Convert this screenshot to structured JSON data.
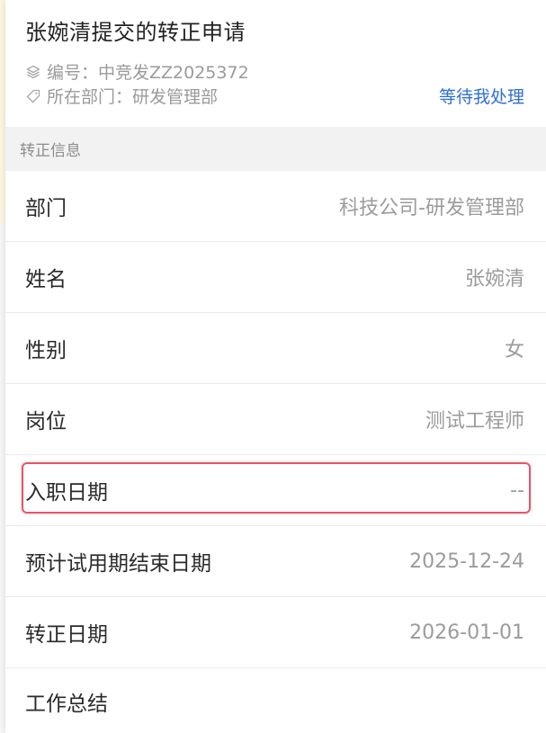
{
  "header": {
    "title": "张婉清提交的转正申请",
    "number_text": "编号：中竞发ZZ2025372",
    "department_text": "所在部门：研发管理部",
    "status_link": "等待我处理"
  },
  "section": {
    "title": "转正信息"
  },
  "fields": [
    {
      "label": "部门",
      "value": "科技公司-研发管理部"
    },
    {
      "label": "姓名",
      "value": "张婉清"
    },
    {
      "label": "性别",
      "value": "女"
    },
    {
      "label": "岗位",
      "value": "测试工程师"
    },
    {
      "label": "入职日期",
      "value": "--"
    },
    {
      "label": "预计试用期结束日期",
      "value": "2025-12-24"
    },
    {
      "label": "转正日期",
      "value": "2026-01-01"
    },
    {
      "label": "工作总结",
      "value": ""
    }
  ],
  "colors": {
    "link": "#2f6fd6",
    "highlight_border": "#e8546b",
    "section_bg": "#f2f2f2"
  },
  "icons": {
    "number": "layers-icon",
    "department": "tag-icon"
  }
}
